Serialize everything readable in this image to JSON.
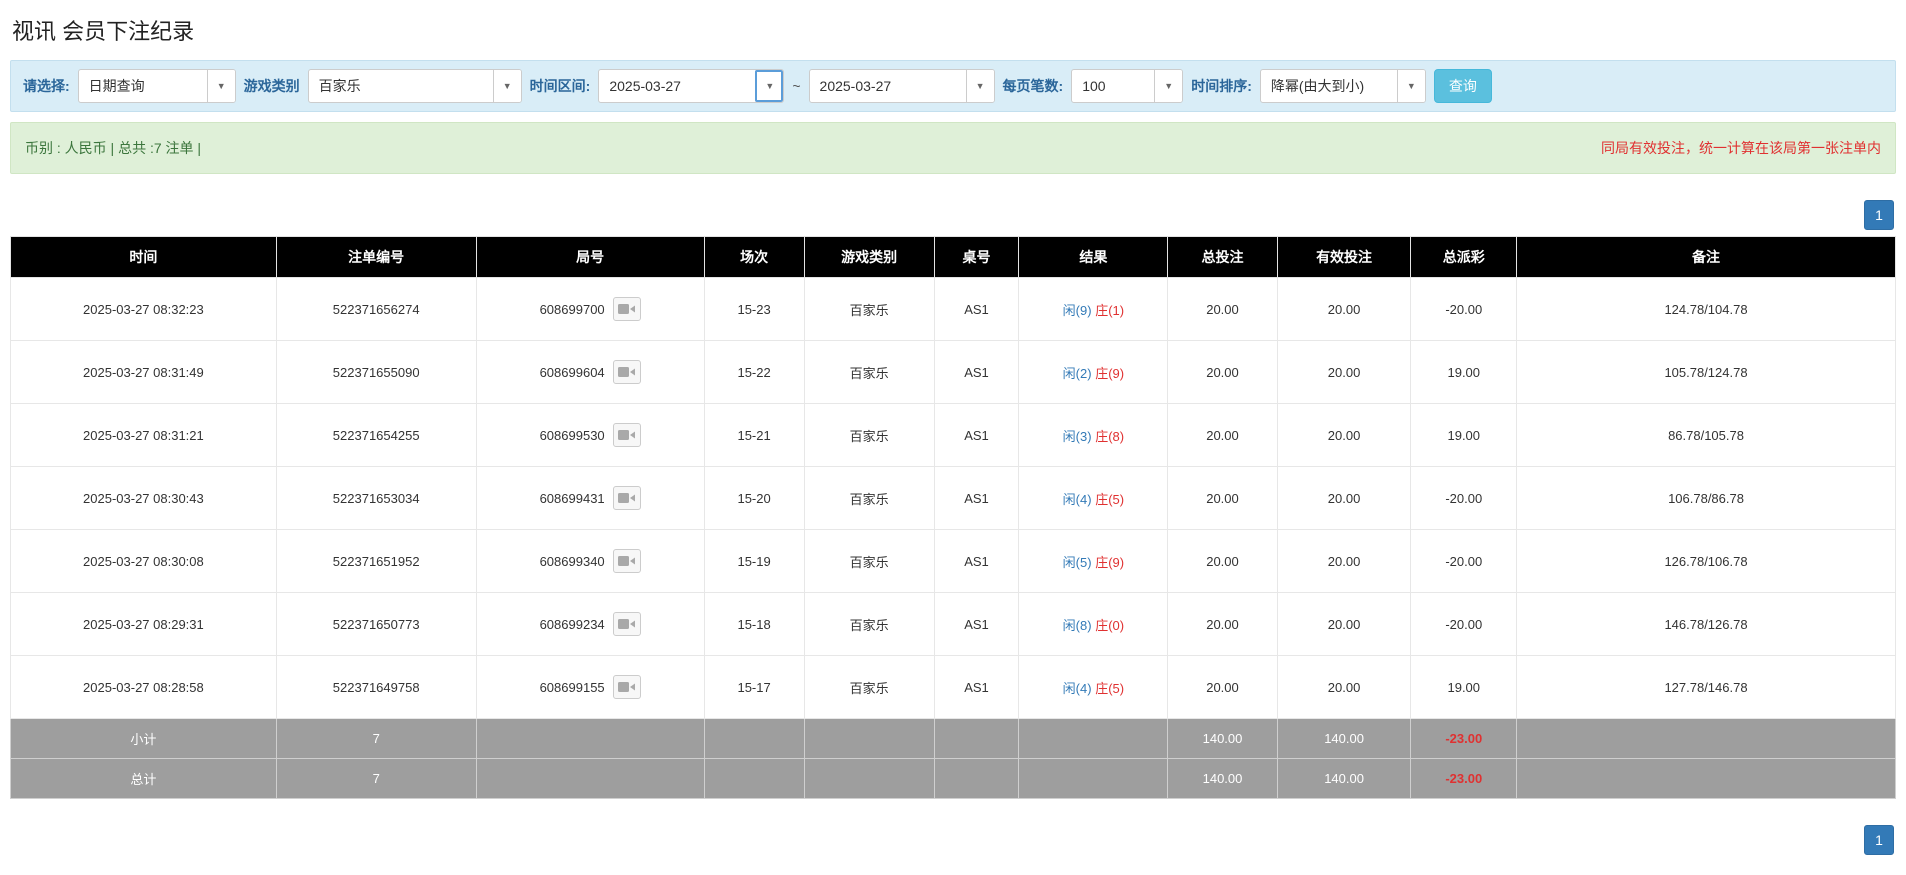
{
  "page": {
    "title": "视讯 会员下注纪录"
  },
  "colors": {
    "accent_blue": "#337ab7",
    "negative_red": "#e03131",
    "header_bg": "#000000",
    "filter_bg": "#d9edf7",
    "summary_bg": "#dff0d8",
    "search_button_bg": "#5bc0de",
    "footer_gray": "#9e9e9e"
  },
  "icons": {
    "caret": "▼",
    "video_replay": "video-camera"
  },
  "filters": {
    "select_label": "请选择:",
    "select_value": "日期查询",
    "game_label": "游戏类别",
    "game_value": "百家乐",
    "range_label": "时间区间:",
    "date_from": "2025-03-27",
    "range_sep": "~",
    "date_to": "2025-03-27",
    "per_page_label": "每页笔数:",
    "per_page_value": "100",
    "sort_label": "时间排序:",
    "sort_value": "降幂(由大到小)",
    "search_button": "查询"
  },
  "summary": {
    "left": "币别 : 人民币 | 总共 :7 注单 |",
    "right": "同局有效投注，统一计算在该局第一张注单内"
  },
  "pagination": {
    "page": "1"
  },
  "table": {
    "headers": {
      "time": "时间",
      "bet_id": "注单编号",
      "round": "局号",
      "session": "场次",
      "game": "游戏类别",
      "table_no": "桌号",
      "result": "结果",
      "total_bet": "总投注",
      "valid_bet": "有效投注",
      "payout": "总派彩",
      "remark": "备注"
    },
    "rows": [
      {
        "time": "2025-03-27 08:32:23",
        "bet_id": "522371656274",
        "round": "608699700",
        "session": "15-23",
        "game": "百家乐",
        "table_no": "AS1",
        "result_player": "闲(9)",
        "result_banker": "庄(1)",
        "total_bet": "20.00",
        "valid_bet": "20.00",
        "payout": "-20.00",
        "remark": "124.78/104.78"
      },
      {
        "time": "2025-03-27 08:31:49",
        "bet_id": "522371655090",
        "round": "608699604",
        "session": "15-22",
        "game": "百家乐",
        "table_no": "AS1",
        "result_player": "闲(2)",
        "result_banker": "庄(9)",
        "total_bet": "20.00",
        "valid_bet": "20.00",
        "payout": "19.00",
        "remark": "105.78/124.78"
      },
      {
        "time": "2025-03-27 08:31:21",
        "bet_id": "522371654255",
        "round": "608699530",
        "session": "15-21",
        "game": "百家乐",
        "table_no": "AS1",
        "result_player": "闲(3)",
        "result_banker": "庄(8)",
        "total_bet": "20.00",
        "valid_bet": "20.00",
        "payout": "19.00",
        "remark": "86.78/105.78"
      },
      {
        "time": "2025-03-27 08:30:43",
        "bet_id": "522371653034",
        "round": "608699431",
        "session": "15-20",
        "game": "百家乐",
        "table_no": "AS1",
        "result_player": "闲(4)",
        "result_banker": "庄(5)",
        "total_bet": "20.00",
        "valid_bet": "20.00",
        "payout": "-20.00",
        "remark": "106.78/86.78"
      },
      {
        "time": "2025-03-27 08:30:08",
        "bet_id": "522371651952",
        "round": "608699340",
        "session": "15-19",
        "game": "百家乐",
        "table_no": "AS1",
        "result_player": "闲(5)",
        "result_banker": "庄(9)",
        "total_bet": "20.00",
        "valid_bet": "20.00",
        "payout": "-20.00",
        "remark": "126.78/106.78"
      },
      {
        "time": "2025-03-27 08:29:31",
        "bet_id": "522371650773",
        "round": "608699234",
        "session": "15-18",
        "game": "百家乐",
        "table_no": "AS1",
        "result_player": "闲(8)",
        "result_banker": "庄(0)",
        "total_bet": "20.00",
        "valid_bet": "20.00",
        "payout": "-20.00",
        "remark": "146.78/126.78"
      },
      {
        "time": "2025-03-27 08:28:58",
        "bet_id": "522371649758",
        "round": "608699155",
        "session": "15-17",
        "game": "百家乐",
        "table_no": "AS1",
        "result_player": "闲(4)",
        "result_banker": "庄(5)",
        "total_bet": "20.00",
        "valid_bet": "20.00",
        "payout": "19.00",
        "remark": "127.78/146.78"
      }
    ],
    "footer": [
      {
        "label": "小计",
        "count": "7",
        "total_bet": "140.00",
        "valid_bet": "140.00",
        "payout": "-23.00"
      },
      {
        "label": "总计",
        "count": "7",
        "total_bet": "140.00",
        "valid_bet": "140.00",
        "payout": "-23.00"
      }
    ]
  }
}
